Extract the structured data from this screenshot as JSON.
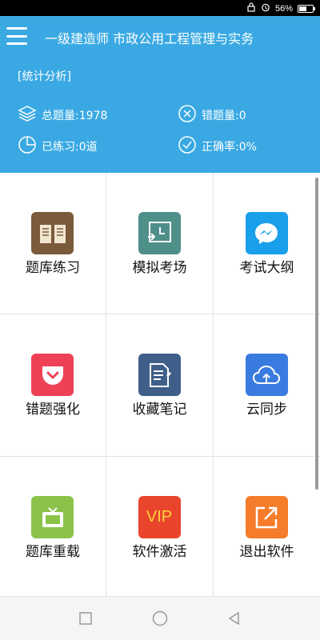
{
  "status_bar": {
    "battery": "56%",
    "battery_level": 0.56
  },
  "header": {
    "title": "一级建造师 市政公用工程管理与实务",
    "section_label": "[统计分析]",
    "stats": {
      "total": "总题量:1978",
      "wrong": "错题量:0",
      "practiced": "已练习:0道",
      "accuracy": "正确率:0%"
    }
  },
  "tiles": [
    {
      "label": "题库练习",
      "icon": "book-icon",
      "color": "#7a5a3a"
    },
    {
      "label": "模拟考场",
      "icon": "clock-arrow-icon",
      "color": "#4f8f8a"
    },
    {
      "label": "考试大纲",
      "icon": "messenger-icon",
      "color": "#1a9fea"
    },
    {
      "label": "错题强化",
      "icon": "pocket-icon",
      "color": "#ee4156"
    },
    {
      "label": "收藏笔记",
      "icon": "note-icon",
      "color": "#3f5f8a"
    },
    {
      "label": "云同步",
      "icon": "cloud-upload-icon",
      "color": "#3a7be0"
    },
    {
      "label": "题库重载",
      "icon": "tv-icon",
      "color": "#8bc34a"
    },
    {
      "label": "软件激活",
      "icon": "vip-icon",
      "color": "#e8452c",
      "text": "VIP"
    },
    {
      "label": "退出软件",
      "icon": "exit-icon",
      "color": "#f57c2a"
    }
  ],
  "navbar": {
    "items": [
      "recent-apps-icon",
      "home-icon",
      "back-icon"
    ]
  }
}
